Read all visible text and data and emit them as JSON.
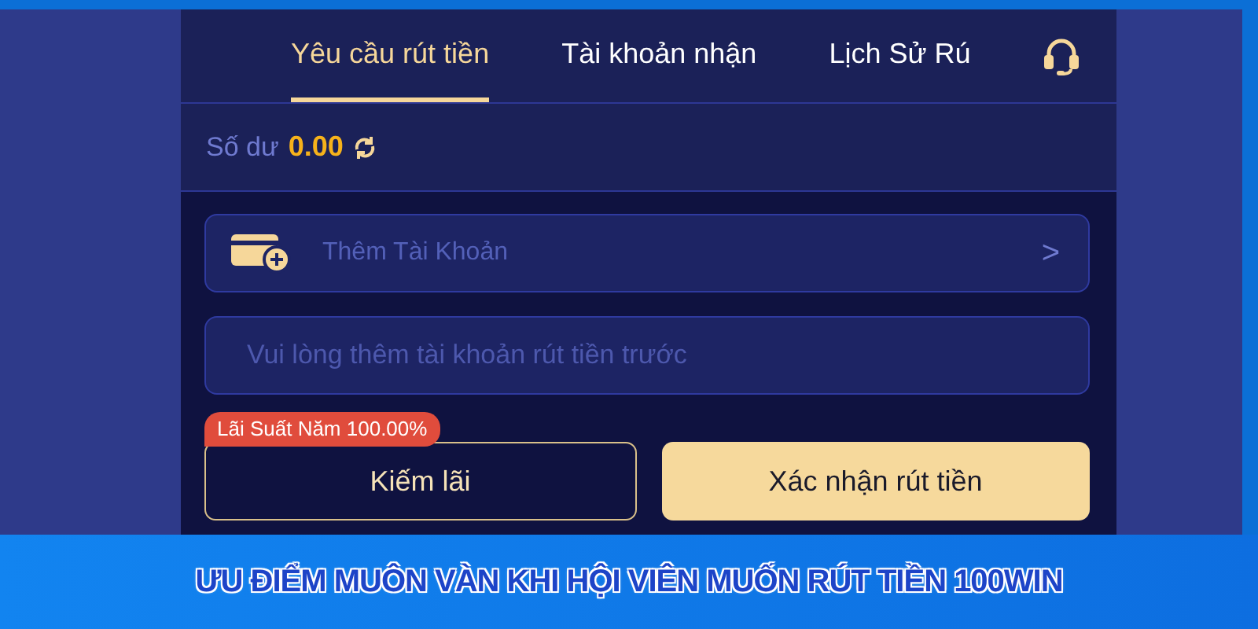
{
  "tabs": [
    {
      "label": "Yêu cầu rút tiền",
      "selected": true
    },
    {
      "label": "Tài khoản nhận",
      "selected": false
    },
    {
      "label": "Lịch Sử Rú",
      "selected": false
    }
  ],
  "balance": {
    "label": "Số dư",
    "amount": "0.00"
  },
  "add_account": {
    "label": "Thêm Tài Khoản",
    "chevron": ">"
  },
  "account_field": {
    "placeholder": "Vui lòng thêm tài khoản rút tiền trước"
  },
  "interest_badge": "Lãi Suất Năm 100.00%",
  "buttons": [
    {
      "label": "Kiếm lãi",
      "kind": "outline"
    },
    {
      "label": "Xác nhận rút tiền",
      "kind": "primary"
    }
  ],
  "caption": "ƯU ĐIỂM MUÔN VÀN KHI HỘI VIÊN MUỐN RÚT TIỀN 100WIN"
}
